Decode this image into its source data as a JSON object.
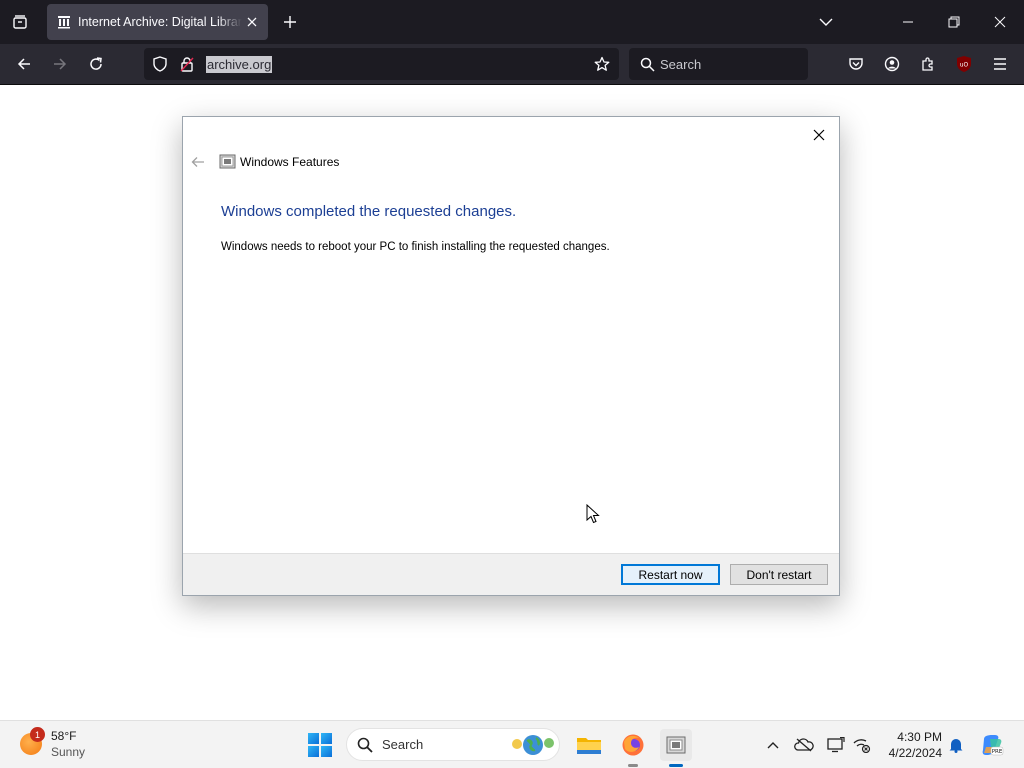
{
  "browser": {
    "tab": {
      "title": "Internet Archive: Digital Library"
    },
    "url": "archive.org",
    "search_placeholder": "Search",
    "colors": {
      "tabbar": "#1c1b22",
      "navbar": "#2b2a33",
      "tab_active": "#42414d"
    }
  },
  "dialog": {
    "app_title": "Windows Features",
    "heading": "Windows completed the requested changes.",
    "message": "Windows needs to reboot your PC to finish installing the requested changes.",
    "buttons": {
      "restart": "Restart now",
      "dont_restart": "Don't restart"
    },
    "colors": {
      "heading": "#1c3f94",
      "primary_border": "#0078d7"
    }
  },
  "taskbar": {
    "weather": {
      "temp": "58°F",
      "condition": "Sunny",
      "badge": "1"
    },
    "search_placeholder": "Search",
    "clock": {
      "time": "4:30 PM",
      "date": "4/22/2024"
    },
    "apps": [
      "file-explorer",
      "firefox",
      "windows-features"
    ],
    "tray_icons": [
      "chevron-up-icon",
      "onedrive-icon",
      "display-icon",
      "network-icon",
      "notification-bell-icon",
      "copilot-icon"
    ]
  }
}
